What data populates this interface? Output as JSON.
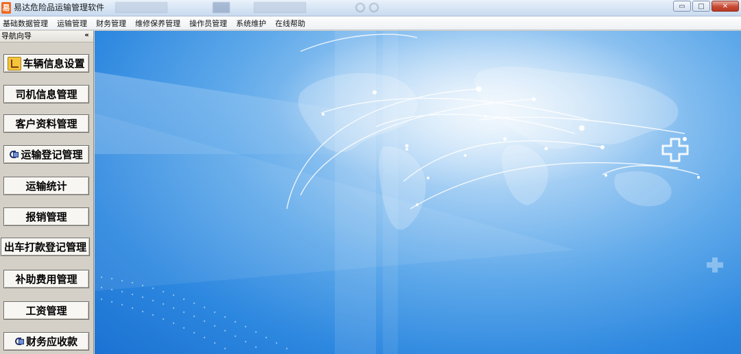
{
  "window": {
    "title": "易达危险品运输管理软件",
    "app_icon_glyph": "易",
    "controls": {
      "minimize": "▭",
      "maximize": "□",
      "close": "✕"
    }
  },
  "menubar": {
    "items": [
      "基础数据管理",
      "运输管理",
      "财务管理",
      "维修保养管理",
      "操作员管理",
      "系统维护",
      "在线帮助"
    ]
  },
  "nav": {
    "title": "导航向导",
    "collapse_glyph": "«",
    "buttons": [
      {
        "label": "车辆信息设置",
        "icon": "vehicle-key-icon"
      },
      {
        "label": "司机信息管理",
        "icon": ""
      },
      {
        "label": "客户资料管理",
        "icon": ""
      },
      {
        "label": "运输登记管理",
        "icon": "transport-icon"
      },
      {
        "label": "运输统计",
        "icon": ""
      },
      {
        "label": "报销管理",
        "icon": ""
      },
      {
        "label": "出车打款登记管理",
        "icon": ""
      },
      {
        "label": "补助费用管理",
        "icon": ""
      },
      {
        "label": "工资管理",
        "icon": ""
      },
      {
        "label": "财务应收款",
        "icon": "finance-icon"
      }
    ]
  },
  "colors": {
    "background_blue": "#2c87df",
    "highlight": "#d8ebfb",
    "close_button": "#c74a33",
    "app_icon": "#f06a1e"
  }
}
